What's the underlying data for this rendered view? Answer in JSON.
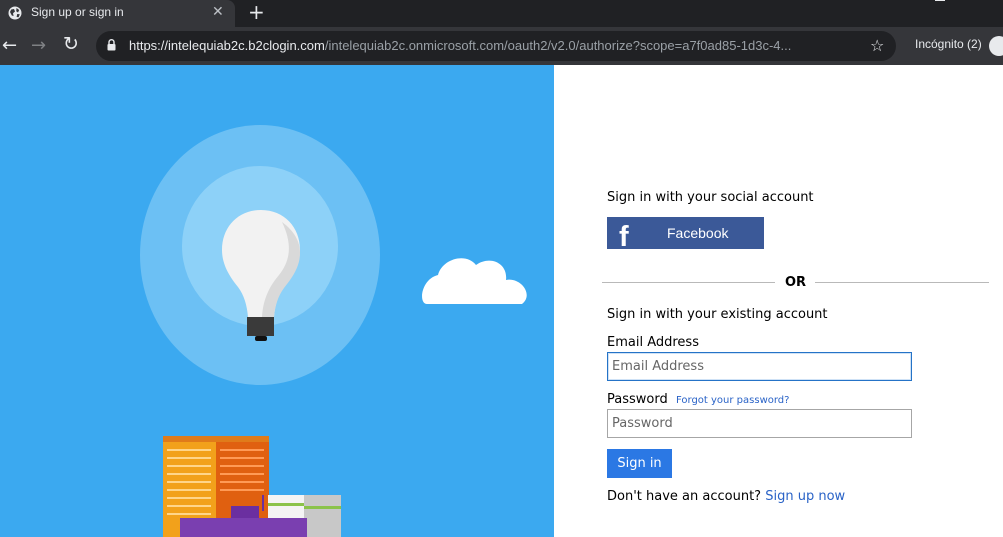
{
  "browser": {
    "tab_title": "Sign up or sign in",
    "tab_close": "✕",
    "new_tab": "+",
    "url_host": "https://intelequiab2c.b2clogin.com",
    "url_path": "/intelequiab2c.onmicrosoft.com/oauth2/v2.0/authorize?scope=a7f0ad85-1d3c-4...",
    "incognito_label": "Incógnito (2)"
  },
  "signin": {
    "social_heading": "Sign in with your social account",
    "facebook_logo": "f",
    "facebook_label": "Facebook",
    "or_label": "OR",
    "existing_heading": "Sign in with your existing account",
    "email_label": "Email Address",
    "email_placeholder": "Email Address",
    "password_label": "Password",
    "forgot_link": "Forgot your password?",
    "password_placeholder": "Password",
    "signin_button": "Sign in",
    "no_account_text": "Don't have an account?",
    "signup_link": "Sign up now"
  },
  "colors": {
    "panel_bg": "#3ba9f0",
    "facebook": "#3b5998",
    "primary_button": "#2b78e4",
    "link": "#2a63c7"
  }
}
